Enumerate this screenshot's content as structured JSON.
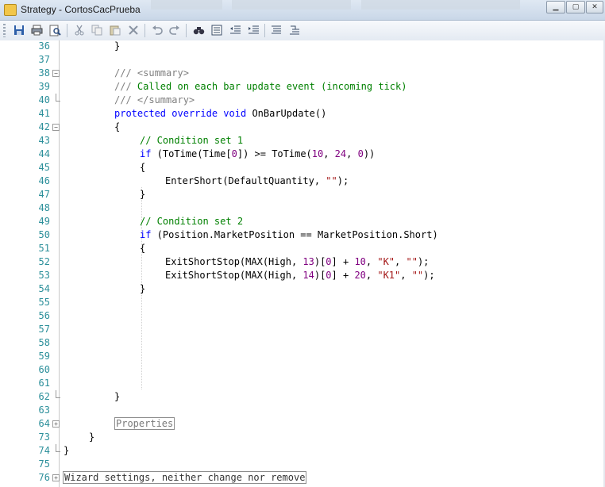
{
  "window": {
    "title": "Strategy - CortosCacPrueba",
    "buttons": {
      "minimize": "▁",
      "maximize": "▢",
      "close": "✕"
    }
  },
  "toolbar": {
    "icons": [
      "save-icon",
      "print-icon",
      "print-preview-icon",
      "cut-icon",
      "copy-icon",
      "paste-icon",
      "delete-icon",
      "undo-icon",
      "redo-icon",
      "find-icon",
      "find-replace-icon",
      "outdent-icon",
      "indent-icon",
      "comment-icon",
      "uncomment-icon"
    ]
  },
  "editor": {
    "line_numbers": [
      "36",
      "37",
      "38",
      "39",
      "40",
      "41",
      "42",
      "43",
      "44",
      "45",
      "46",
      "47",
      "48",
      "49",
      "50",
      "51",
      "52",
      "53",
      "54",
      "55",
      "56",
      "57",
      "58",
      "59",
      "60",
      "61",
      "62",
      "63",
      "64",
      "73",
      "74",
      "75",
      "76"
    ],
    "lines": {
      "l36": "}",
      "l38_a": "/// ",
      "l38_b": "<summary>",
      "l39_a": "/// ",
      "l39_b": "Called on each bar update event (incoming tick)",
      "l40_a": "/// ",
      "l40_b": "</summary>",
      "l41_kw1": "protected",
      "l41_kw2": "override",
      "l41_kw3": "void",
      "l41_rest": "OnBarUpdate()",
      "l42": "{",
      "l43": "// Condition set 1",
      "l44_kw": "if",
      "l44_a": " (ToTime(Time[",
      "l44_n0": "0",
      "l44_b": "]) >= ToTime(",
      "l44_n1": "10",
      "l44_c": ", ",
      "l44_n2": "24",
      "l44_d": ", ",
      "l44_n3": "0",
      "l44_e": "))",
      "l45": "{",
      "l46_a": "EnterShort(DefaultQuantity, ",
      "l46_s": "\"\"",
      "l46_b": ");",
      "l47": "}",
      "l49": "// Condition set 2",
      "l50_kw": "if",
      "l50_a": " (Position.MarketPosition == MarketPosition.Short)",
      "l51": "{",
      "l52_a": "ExitShortStop(MAX(High, ",
      "l52_n1": "13",
      "l52_b": ")[",
      "l52_n2": "0",
      "l52_c": "] + ",
      "l52_n3": "10",
      "l52_d": ", ",
      "l52_s1": "\"K\"",
      "l52_e": ", ",
      "l52_s2": "\"\"",
      "l52_f": ");",
      "l53_a": "ExitShortStop(MAX(High, ",
      "l53_n1": "14",
      "l53_b": ")[",
      "l53_n2": "0",
      "l53_c": "] + ",
      "l53_n3": "20",
      "l53_d": ", ",
      "l53_s1": "\"K1\"",
      "l53_e": ", ",
      "l53_s2": "\"\"",
      "l53_f": ");",
      "l54": "}",
      "l62": "}",
      "l64": "Properties",
      "l73": "}",
      "l74": "}",
      "l76": "Wizard settings, neither change nor remove"
    }
  },
  "colors": {
    "keyword": "#0000ff",
    "comment": "#008000",
    "line_number": "#2b8f9a",
    "number": "#800080",
    "string": "#a31515"
  }
}
